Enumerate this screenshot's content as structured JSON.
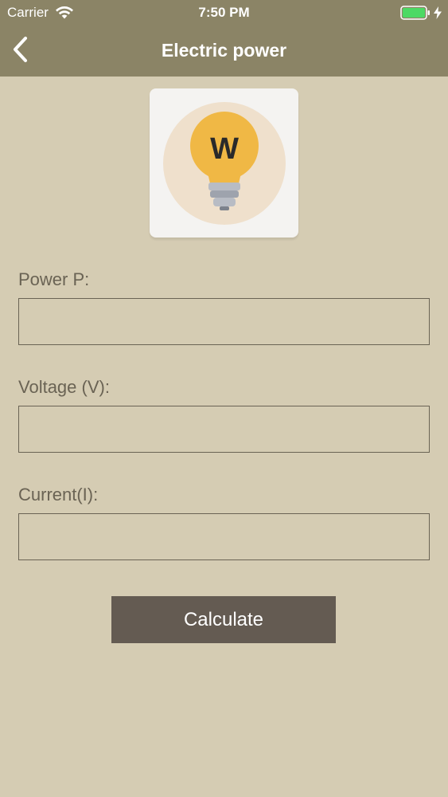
{
  "status_bar": {
    "carrier": "Carrier",
    "time": "7:50 PM",
    "battery_color": "#4cd964"
  },
  "nav": {
    "title": "Electric power",
    "back_icon": "chevron-left-icon"
  },
  "app_icon": {
    "letter": "W",
    "bulb_color": "#f0b845",
    "circle_color": "#efe0cc"
  },
  "form": {
    "fields": [
      {
        "label": "Power P:",
        "value": "",
        "placeholder": ""
      },
      {
        "label": "Voltage (V):",
        "value": "",
        "placeholder": ""
      },
      {
        "label": "Current(I):",
        "value": "",
        "placeholder": ""
      }
    ],
    "submit_label": "Calculate"
  },
  "colors": {
    "header": "#8b8466",
    "background": "#d5ccb3",
    "button": "#645b52"
  }
}
